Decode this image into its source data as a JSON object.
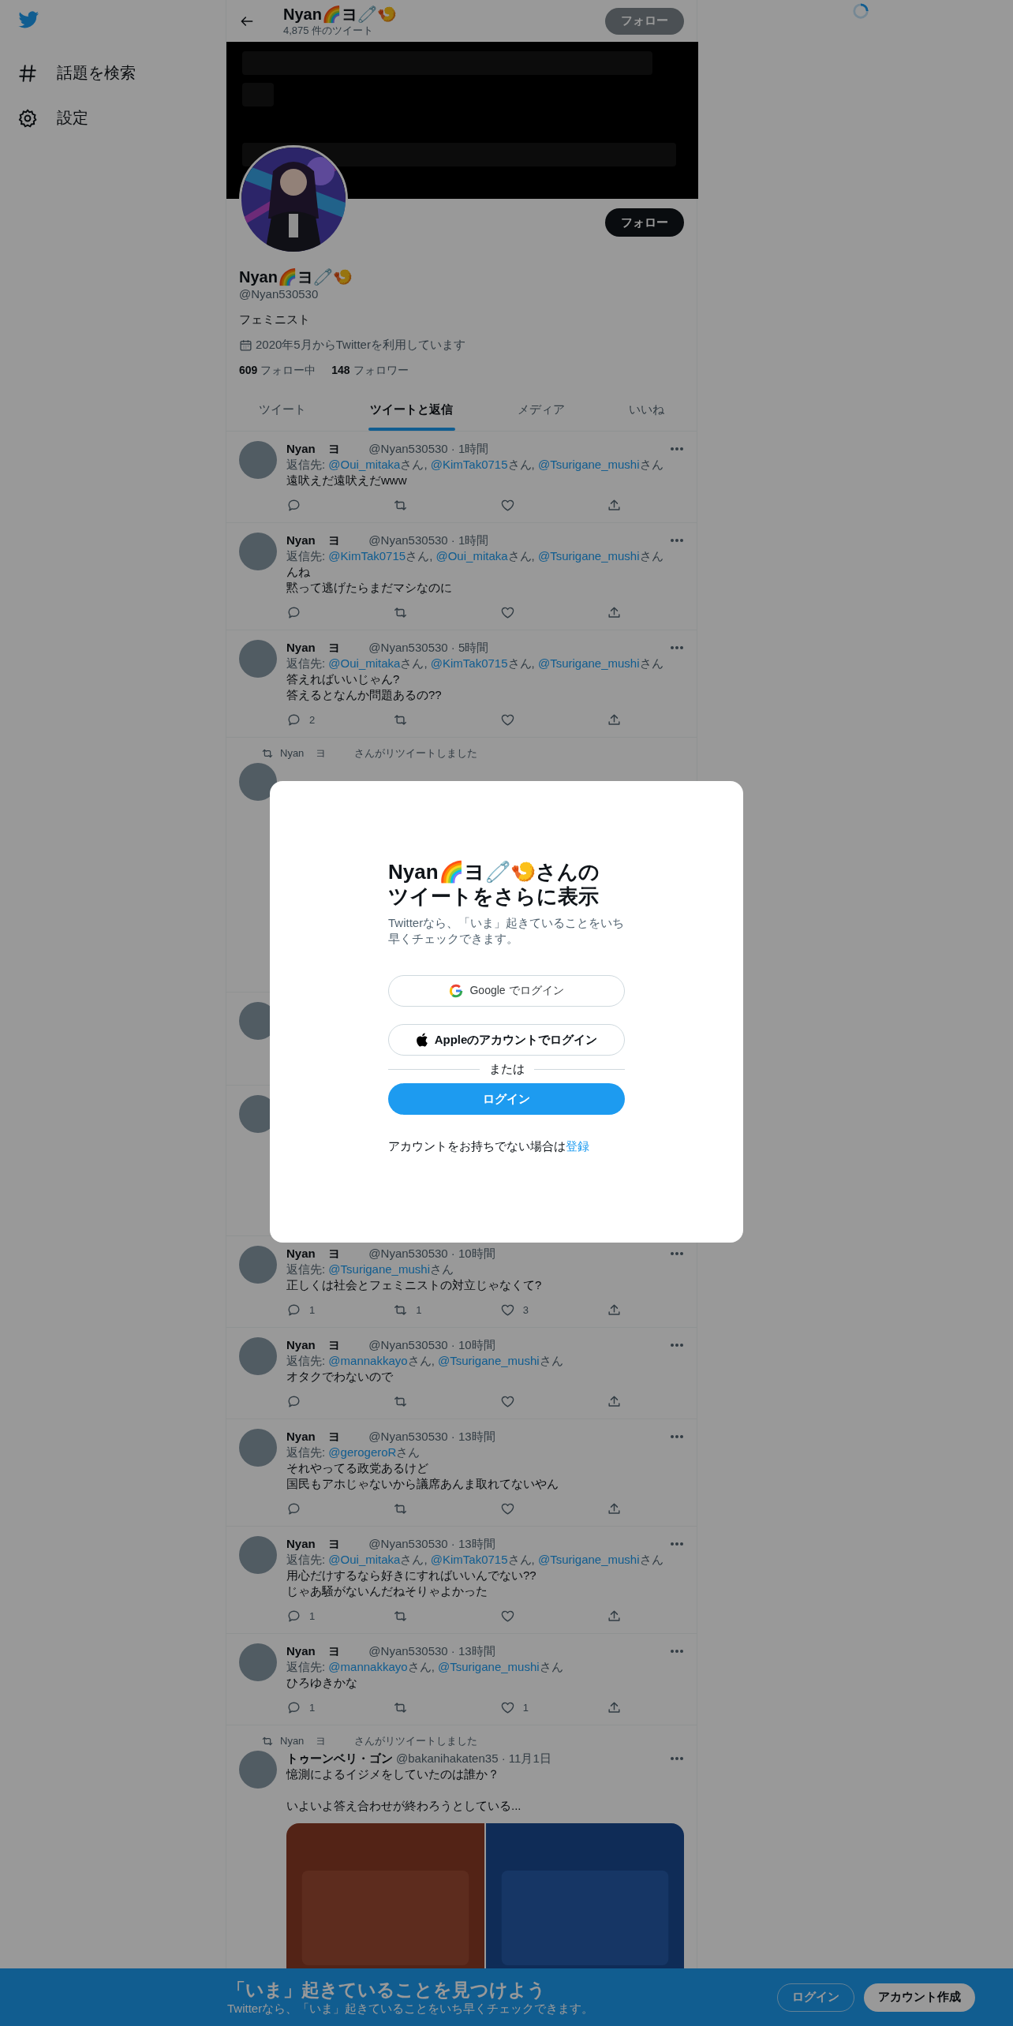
{
  "sidebar": {
    "items": [
      {
        "kind": "search",
        "label": "話題を検索"
      },
      {
        "kind": "settings",
        "label": "設定"
      }
    ]
  },
  "header": {
    "name": "Nyan🌈ヨ🧷🍤",
    "tweet_count": "4,875 件のツイート",
    "follow_button": "フォロー"
  },
  "profile": {
    "follow_button": "フォロー",
    "name": "Nyan🌈ヨ🧷🍤",
    "handle": "@Nyan530530",
    "bio": "フェミニスト",
    "joined": "2020年5月からTwitterを利用しています",
    "following_count": "609",
    "following_label": "フォロー中",
    "followers_count": "148",
    "followers_label": "フォロワー"
  },
  "tabs": [
    {
      "label": "ツイート",
      "selected": false
    },
    {
      "label": "ツイートと返信",
      "selected": true
    },
    {
      "label": "メディア",
      "selected": false
    },
    {
      "label": "いいね",
      "selected": false
    }
  ],
  "tweets_before": [
    {
      "kind": "reply",
      "name": "Nyan    ヨ",
      "meta": "@Nyan530530 · 1時間",
      "reply_label": "返信先:",
      "mentions": [
        {
          "handle": "@Oui_mitaka",
          "suffix": "さん,"
        },
        {
          "handle": "@KimTak0715",
          "suffix": "さん,"
        },
        {
          "handle": "@Tsurigane_mushi",
          "suffix": "さん"
        }
      ],
      "lines": [
        "遠吠えだ遠吠えだwww"
      ]
    },
    {
      "kind": "reply",
      "name": "Nyan    ヨ",
      "meta": "@Nyan530530 · 1時間",
      "reply_label": "返信先:",
      "mentions": [
        {
          "handle": "@KimTak0715",
          "suffix": "さん,"
        },
        {
          "handle": "@Oui_mitaka",
          "suffix": "さん,"
        },
        {
          "handle": "@Tsurigane_mushi",
          "suffix": "さん"
        }
      ],
      "lines": [
        "んね",
        "黙って逃げたらまだマシなのに"
      ]
    },
    {
      "kind": "reply",
      "name": "Nyan    ヨ",
      "meta": "@Nyan530530 · 5時間",
      "reply_label": "返信先:",
      "mentions": [
        {
          "handle": "@Oui_mitaka",
          "suffix": "さん,"
        },
        {
          "handle": "@KimTak0715",
          "suffix": "さん,"
        },
        {
          "handle": "@Tsurigane_mushi",
          "suffix": "さん"
        }
      ],
      "lines": [
        "答えればいいじゃん?",
        "答えるとなんか問題あるの??"
      ],
      "reply_count": "2"
    }
  ],
  "covered": {
    "retweeted_by": "Nyan    ヨ",
    "note": "さんがリツイートしました"
  },
  "tweets_after": [
    {
      "kind": "reply",
      "name": "Nyan    ヨ",
      "meta": "@Nyan530530 · 10時間",
      "reply_label": "返信先:",
      "mentions": [
        {
          "handle": "@Tsurigane_mushi",
          "suffix": "さん"
        }
      ],
      "lines": [
        "正しくは社会とフェミニストの対立じゃなくて?"
      ],
      "reply_count": "1",
      "retweet_count": "1",
      "like_count": "3"
    },
    {
      "kind": "reply",
      "name": "Nyan    ヨ",
      "meta": "@Nyan530530 · 10時間",
      "reply_label": "返信先:",
      "mentions": [
        {
          "handle": "@mannakkayo",
          "suffix": "さん,"
        },
        {
          "handle": "@Tsurigane_mushi",
          "suffix": "さん"
        }
      ],
      "lines": [
        "オタクでわないので"
      ]
    },
    {
      "kind": "reply",
      "name": "Nyan    ヨ",
      "meta": "@Nyan530530 · 13時間",
      "reply_label": "返信先:",
      "mentions": [
        {
          "handle": "@gerogeroR",
          "suffix": "さん"
        }
      ],
      "lines": [
        "それやってる政党あるけど",
        "国民もアホじゃないから議席あんま取れてないやん"
      ]
    },
    {
      "kind": "reply",
      "name": "Nyan    ヨ",
      "meta": "@Nyan530530 · 13時間",
      "reply_label": "返信先:",
      "mentions": [
        {
          "handle": "@Oui_mitaka",
          "suffix": "さん,"
        },
        {
          "handle": "@KimTak0715",
          "suffix": "さん,"
        },
        {
          "handle": "@Tsurigane_mushi",
          "suffix": "さん"
        }
      ],
      "lines": [
        "用心だけするなら好きにすればいいんでない??",
        "じゃあ騒がないんだねそりゃよかった"
      ],
      "reply_count": "1"
    },
    {
      "kind": "reply",
      "name": "Nyan    ヨ",
      "meta": "@Nyan530530 · 13時間",
      "reply_label": "返信先:",
      "mentions": [
        {
          "handle": "@mannakkayo",
          "suffix": "さん,"
        },
        {
          "handle": "@Tsurigane_mushi",
          "suffix": "さん"
        }
      ],
      "lines": [
        "ひろゆきかな"
      ],
      "reply_count": "1",
      "like_count": "1"
    },
    {
      "kind": "retweet",
      "retweeted_by": "Nyan    ヨ",
      "retweet_note": "さんがリツイートしました",
      "name": "トゥーンベリ・ゴン",
      "meta": "@bakanihakaten35 · 11月1日",
      "paragraphs": [
        "憶測によるイジメをしていたのは誰か？",
        "いよいよ答え合わせが終わろうとしている..."
      ],
      "media": [
        {
          "kind": "picture"
        },
        {
          "kind": "picture"
        }
      ]
    }
  ],
  "modal": {
    "title": "Nyan🌈ヨ🧷🍤さんのツイートをさらに表示",
    "subtitle": "Twitterなら、「いま」起きていることをいち早くチェックできます。",
    "google_button": "Google でログイン",
    "apple_button": "Appleのアカウントでログイン",
    "divider": "または",
    "login_button": "ログイン",
    "signup_prompt": "アカウントをお持ちでない場合は",
    "signup_link": "登録"
  },
  "bottom_bar": {
    "title": "「いま」起きていることを見つけよう",
    "subtitle": "Twitterなら、「いま」起きていることをいち早くチェックできます。",
    "login_button": "ログイン",
    "signup_button": "アカウント作成"
  }
}
